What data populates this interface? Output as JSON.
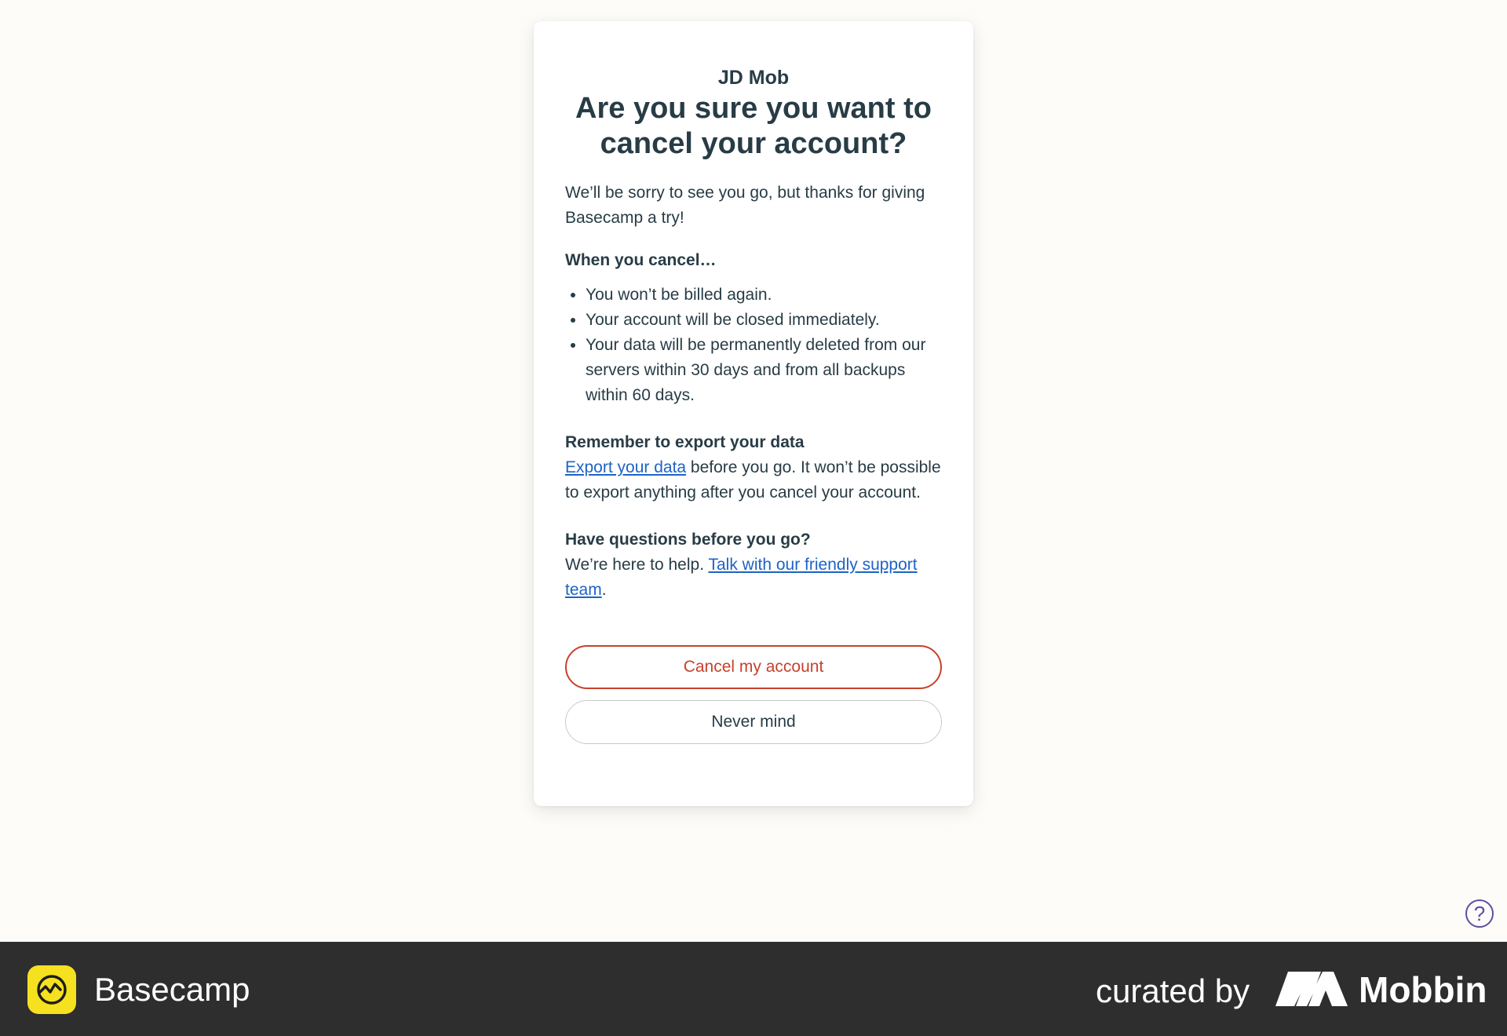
{
  "card": {
    "account_name": "JD Mob",
    "headline": "Are you sure you want to cancel your account?",
    "intro": "We’ll be sorry to see you go, but thanks for giving Basecamp a try!",
    "when_heading": "When you cancel…",
    "consequences": [
      "You won’t be billed again.",
      "Your account will be closed immediately.",
      "Your data will be permanently deleted from our servers within 30 days and from all backups within 60 days."
    ],
    "export_heading": "Remember to export your data",
    "export_link": "Export your data",
    "export_text": " before you go. It won’t be possible to export anything after you cancel your account.",
    "questions_heading": "Have questions before you go?",
    "questions_text": "We’re here to help. ",
    "support_link": "Talk with our friendly support team",
    "questions_end": ".",
    "cancel_button": "Cancel my account",
    "never_mind_button": "Never mind"
  },
  "help_button": "?",
  "footer": {
    "brand": "Basecamp",
    "curated_by": "curated by",
    "curator": "Mobbin"
  },
  "colors": {
    "danger": "#c7422b",
    "link": "#1e63c4",
    "text": "#283c46",
    "basecamp_yellow": "#f5e11f",
    "footer_bg": "#2e2e2e"
  }
}
